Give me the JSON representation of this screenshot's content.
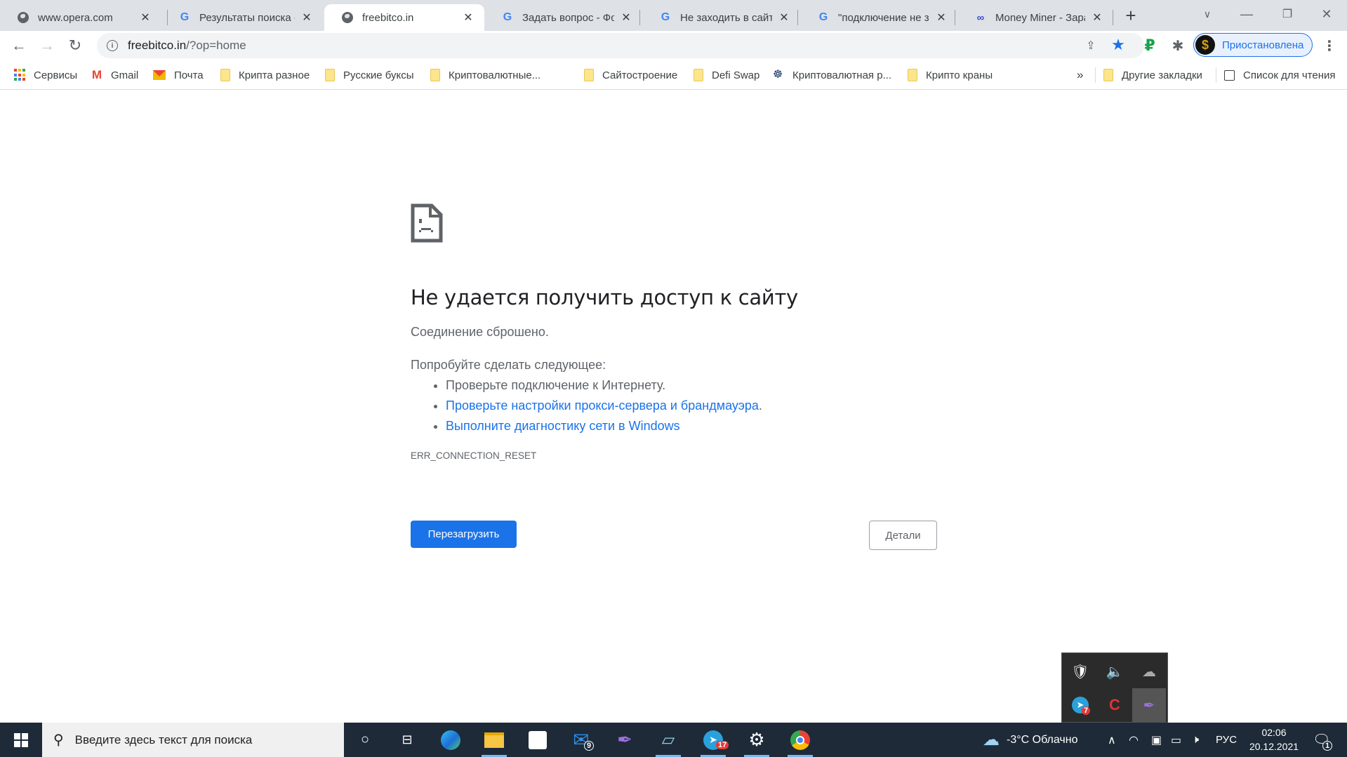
{
  "browser": {
    "tabs": [
      {
        "title": "www.opera.com",
        "favicon": "globe-icon",
        "active": false
      },
      {
        "title": "Результаты поиска - ",
        "favicon": "google-icon",
        "active": false
      },
      {
        "title": "freebitco.in",
        "favicon": "globe-icon",
        "active": true
      },
      {
        "title": "Задать вопрос - Фору",
        "favicon": "google-icon",
        "active": false
      },
      {
        "title": "Не заходить в сайт - ",
        "favicon": "google-icon",
        "active": false
      },
      {
        "title": "\"подключение не за",
        "favicon": "google-icon",
        "active": false
      },
      {
        "title": "Money Miner - Зараб",
        "favicon": "money-miner-icon",
        "active": false
      }
    ],
    "new_tab_label": "+",
    "address": {
      "host": "freebitco.in",
      "path": "/?op=home"
    },
    "profile_label": "Приостановлена",
    "bookmarks": [
      {
        "label": "Сервисы",
        "icon": "apps-grid-icon"
      },
      {
        "label": "Gmail",
        "icon": "gmail-icon"
      },
      {
        "label": "Почта",
        "icon": "mail-icon"
      },
      {
        "label": "Крипта разное",
        "icon": "folder-icon"
      },
      {
        "label": "Русские буксы",
        "icon": "folder-icon"
      },
      {
        "label": "Криптовалютные...",
        "icon": "folder-icon"
      },
      {
        "label": "Сайтостроение",
        "icon": "folder-icon"
      },
      {
        "label": "Defi Swap",
        "icon": "folder-icon"
      },
      {
        "label": "Криптовалютная р...",
        "icon": "site-icon"
      },
      {
        "label": "Крипто краны",
        "icon": "folder-icon"
      }
    ],
    "bookmarks_overflow": "»",
    "other_bookmarks": "Другие закладки",
    "reading_list": "Список для чтения"
  },
  "error_page": {
    "heading": "Не удается получить доступ к сайту",
    "subtext": "Соединение сброшено.",
    "try_label": "Попробуйте сделать следующее:",
    "suggestions": [
      {
        "text": "Проверьте подключение к Интернету.",
        "link": false
      },
      {
        "text": "Проверьте настройки прокси-сервера и брандмауэра",
        "link": true,
        "suffix": "."
      },
      {
        "text": "Выполните диагностику сети в Windows",
        "link": true,
        "suffix": ""
      }
    ],
    "error_code": "ERR_CONNECTION_RESET",
    "reload_button": "Перезагрузить",
    "details_button": "Детали"
  },
  "taskbar": {
    "search_placeholder": "Введите здесь текст для поиска",
    "mail_badge": "9",
    "telegram_badge": "17",
    "weather": "-3°C  Облачно",
    "language": "РУС",
    "time": "02:06",
    "date": "20.12.2021",
    "notifications_badge": "1",
    "tray_telegram_badge": "7"
  },
  "colors": {
    "accent": "#1a73e8",
    "taskbar": "#1e2a38",
    "tabstrip": "#dee1e6"
  }
}
